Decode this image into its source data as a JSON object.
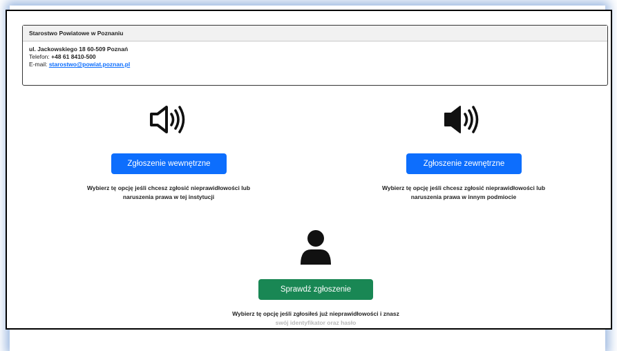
{
  "office": {
    "name": "Starostwo Powiatowe w Poznaniu",
    "address": "ul. Jackowskiego 18 60-509 Poznań",
    "phone_label": "Telefon: ",
    "phone": "+48 61 8410-500",
    "email_label": "E-mail: ",
    "email": "starostwo@powiat.poznan.pl"
  },
  "options": {
    "internal": {
      "button": "Zgłoszenie wewnętrzne",
      "desc_line1": "Wybierz tę opcję jeśli chcesz zgłosić nieprawidłowości lub",
      "desc_line2": "naruszenia prawa w tej instytucji",
      "icon": "speaker-outline-icon"
    },
    "external": {
      "button": "Zgłoszenie zewnętrzne",
      "desc_line1": "Wybierz tę opcję jeśli chcesz zgłosić nieprawidłowości lub",
      "desc_line2": "naruszenia prawa w innym podmiocie",
      "icon": "speaker-filled-icon"
    },
    "check": {
      "button": "Sprawdź zgłoszenie",
      "desc_line1": "Wybierz tę opcję jeśli zgłosiłeś już nieprawidłowości i znasz",
      "desc_line2": "swój identyfikator oraz hasło",
      "icon": "user-icon"
    }
  },
  "colors": {
    "primary": "#0d6efd",
    "success": "#198754",
    "text": "#222222"
  }
}
